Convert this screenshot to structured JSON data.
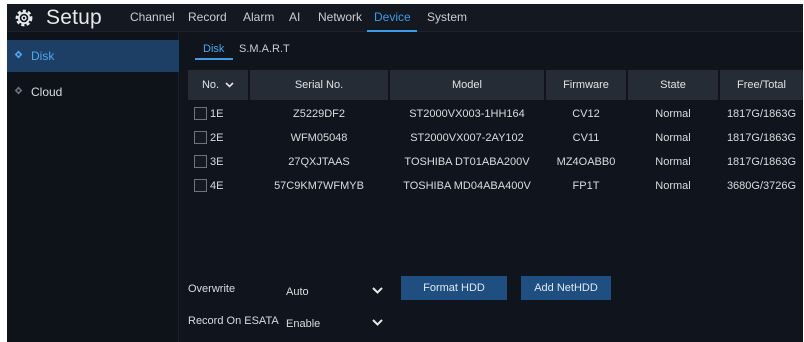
{
  "header": {
    "title": "Setup",
    "nav": [
      "Channel",
      "Record",
      "Alarm",
      "AI",
      "Network",
      "Device",
      "System"
    ],
    "active_nav": "Device"
  },
  "sidebar": {
    "items": [
      {
        "label": "Disk",
        "active": true,
        "icon": "disk-icon"
      },
      {
        "label": "Cloud",
        "active": false,
        "icon": "cloud-icon"
      }
    ]
  },
  "subtabs": [
    "Disk",
    "S.M.A.R.T"
  ],
  "table": {
    "headers": [
      "No.",
      "Serial No.",
      "Model",
      "Firmware",
      "State",
      "Free/Total"
    ],
    "rows": [
      {
        "no": "1E",
        "serial": "Z5229DF2",
        "model": "ST2000VX003-1HH164",
        "firmware": "CV12",
        "state": "Normal",
        "free_total": "1817G/1863G"
      },
      {
        "no": "2E",
        "serial": "WFM05048",
        "model": "ST2000VX007-2AY102",
        "firmware": "CV11",
        "state": "Normal",
        "free_total": "1817G/1863G"
      },
      {
        "no": "3E",
        "serial": "27QXJTAAS",
        "model": "TOSHIBA DT01ABA200V",
        "firmware": "MZ4OABB0",
        "state": "Normal",
        "free_total": "1817G/1863G"
      },
      {
        "no": "4E",
        "serial": "57C9KM7WFMYB",
        "model": "TOSHIBA MD04ABA400V",
        "firmware": "FP1T",
        "state": "Normal",
        "free_total": "3680G/3726G"
      }
    ]
  },
  "controls": {
    "overwrite_label": "Overwrite",
    "overwrite_value": "Auto",
    "esata_label": "Record On ESATA",
    "esata_value": "Enable",
    "format_button": "Format HDD",
    "add_button": "Add NetHDD"
  },
  "colors": {
    "accent": "#3e9ce6",
    "sidebar_active": "#1d3f66",
    "button": "#1e4f80",
    "background": "#10141c"
  }
}
